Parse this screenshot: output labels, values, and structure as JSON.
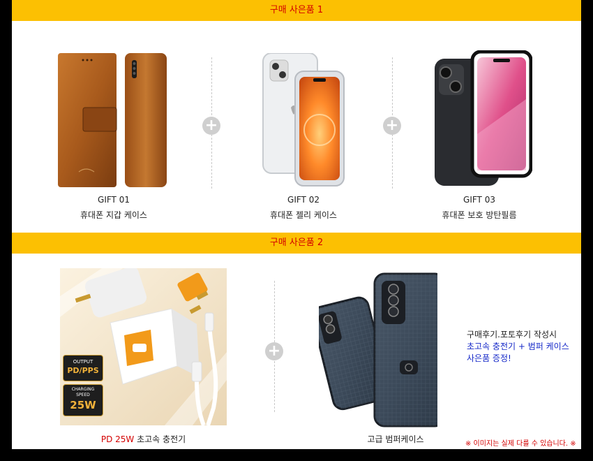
{
  "section1": {
    "banner": "구매 사은품 1",
    "gifts": [
      {
        "code": "GIFT 01",
        "name": "휴대폰 지갑 케이스",
        "icon": "wallet-case-image"
      },
      {
        "code": "GIFT 02",
        "name": "휴대폰 젤리 케이스",
        "icon": "jelly-case-image"
      },
      {
        "code": "GIFT 03",
        "name": "휴대폰 보호 방탄필름",
        "icon": "screen-film-image"
      }
    ]
  },
  "section2": {
    "banner": "구매 사은품 2",
    "charger": {
      "caption_accent": "PD 25W",
      "caption_rest": " 초고속 충전기",
      "badge_output_label": "OUTPUT",
      "badge_output_value": "PD/PPS",
      "badge_speed_label": "CHARGING SPEED",
      "badge_speed_value": "25W"
    },
    "bumper": {
      "caption": "고급 범퍼케이스"
    },
    "promo": {
      "line1": "구매후기.포토후기 작성시",
      "line2": "초고속 충전기 + 범퍼 케이스",
      "line3": "사은품 증정!"
    },
    "note": "※ 이미지는 실제 다를 수 있습니다. ※"
  },
  "colors": {
    "banner": "#fcc002",
    "accent_red": "#d30000",
    "accent_blue": "#1528c8",
    "frame": "#000000"
  }
}
